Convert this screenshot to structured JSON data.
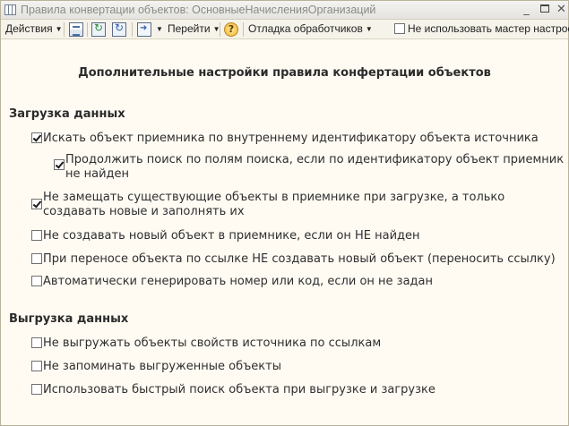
{
  "window": {
    "title": "Правила конвертации объектов: ОсновныеНачисленияОрганизаций",
    "minimize": "_",
    "close": "✕"
  },
  "toolbar": {
    "actions_label": "Действия",
    "goto_label": "Перейти",
    "help_label": "?",
    "debug_label": "Отладка обработчиков",
    "no_wizard_label": "Не использовать мастер настроек",
    "no_wizard_checked": false
  },
  "main": {
    "heading": "Дополнительные настройки правила конфертации объектов",
    "load_section": {
      "title": "Загрузка данных",
      "options": [
        {
          "line1": "Искать объект приемника по внутреннему идентификатору объекта источника",
          "line2": "",
          "checked": true
        },
        {
          "line1": "Продолжить поиск по полям поиска, если по идентификатору объект приемник",
          "line2": "не найден",
          "checked": true
        },
        {
          "line1": "Не замещать существующие объекты в приемнике при загрузке, а только",
          "line2": "создавать новые и заполнять их",
          "checked": true
        },
        {
          "line1": "Не создавать новый объект в приемнике, если он НЕ найден",
          "line2": "",
          "checked": false
        },
        {
          "line1": "При переносе объекта по ссылке НЕ создавать новый объект (переносить ссылку)",
          "line2": "",
          "checked": false
        },
        {
          "line1": "Автоматически генерировать номер или код, если он не задан",
          "line2": "",
          "checked": false
        }
      ]
    },
    "unload_section": {
      "title": "Выгрузка данных",
      "options": [
        {
          "line1": "Не выгружать объекты свойств источника по ссылкам",
          "checked": false
        },
        {
          "line1": "Не запоминать выгруженные объекты",
          "checked": false
        },
        {
          "line1": "Использовать быстрый поиск объекта при выгрузке и загрузке",
          "checked": false
        }
      ]
    }
  }
}
